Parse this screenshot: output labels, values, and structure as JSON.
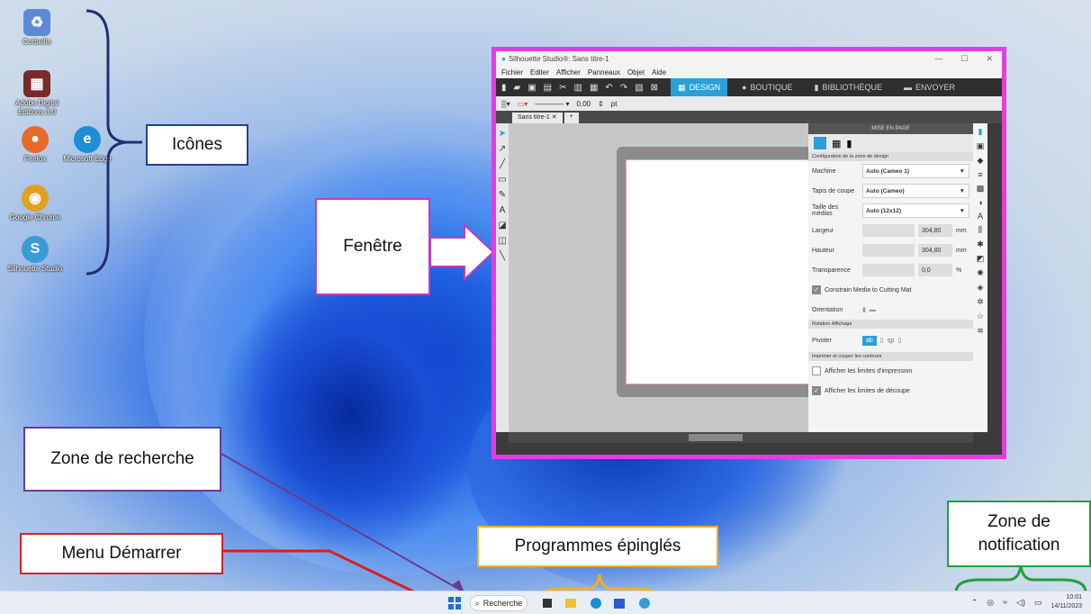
{
  "desktop": {
    "icons": [
      {
        "label": "Corbeille",
        "glyph": "♻",
        "color": "#5c8ad6"
      },
      {
        "label": "Adobe Digital Editions 3.0",
        "glyph": "▦",
        "color": "#7a2a2a"
      },
      {
        "label": "Firefox",
        "glyph": "●",
        "color": "#e86a2a"
      },
      {
        "label": "Microsoft Edge",
        "glyph": "e",
        "color": "#1e8fd6"
      },
      {
        "label": "Google Chrome",
        "glyph": "◉",
        "color": "#e0a020"
      },
      {
        "label": "Silhouette Studio",
        "glyph": "S",
        "color": "#3a9ad8"
      }
    ]
  },
  "annotations": {
    "icons": "Icônes",
    "window": "Fenêtre",
    "search": "Zone de recherche",
    "start": "Menu Démarrer",
    "pinned": "Programmes épinglés",
    "notification": "Zone de notification"
  },
  "app": {
    "title": "Silhouette Studio®: Sans titre-1",
    "menus": [
      "Fichier",
      "Editer",
      "Afficher",
      "Panneaux",
      "Objet",
      "Aide"
    ],
    "tabs": [
      "DESIGN",
      "BOUTIQUE",
      "BIBLIOTHÈQUE",
      "ENVOYER"
    ],
    "line_width": "0,00",
    "line_unit": "pt",
    "doc_tab": "Sans titre-1",
    "panel": {
      "header": "MISE EN PAGE",
      "section1": "Configuration de la zone de design",
      "machine_label": "Machine",
      "machine_value": "Auto (Cameo 1)",
      "mat_label": "Tapis de coupe",
      "mat_value": "Auto (Cameo)",
      "media_label": "Taille des médias",
      "media_value": "Auto (12x12)",
      "width_label": "Largeur",
      "width_value": "304,80",
      "height_label": "Hauteur",
      "height_value": "304,80",
      "unit": "mm",
      "transparency_label": "Transparence",
      "transparency_value": "0,0",
      "percent": "%",
      "constrain": "Constrain Media to Cutting Mat",
      "orientation": "Orientation",
      "section2": "Rotation Affichage",
      "rotate": "Pivoter",
      "section3": "Imprimer et couper les contours",
      "print_limits": "Afficher les limites d'impression",
      "cut_limits": "Afficher les limites de découpe"
    }
  },
  "taskbar": {
    "search": "Recherche",
    "time": "10:01",
    "date": "14/11/2023"
  }
}
